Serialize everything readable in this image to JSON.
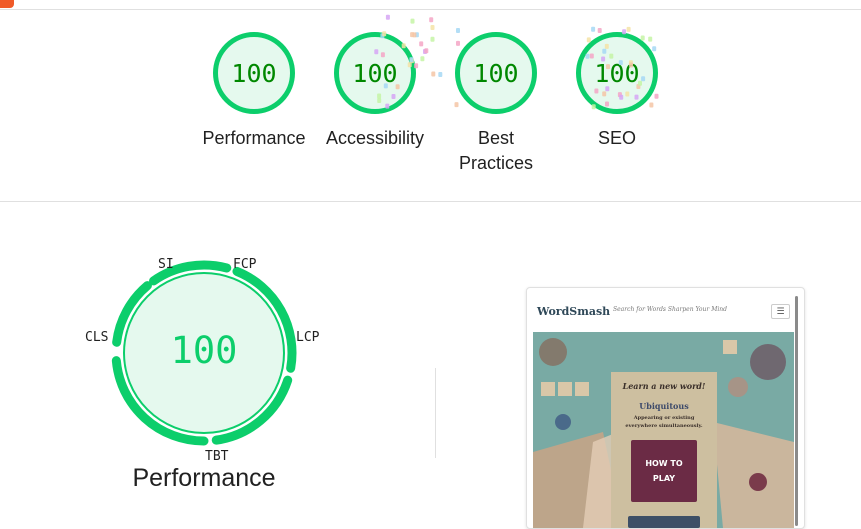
{
  "categories": [
    {
      "id": "performance",
      "score": "100",
      "label": "Performance"
    },
    {
      "id": "accessibility",
      "score": "100",
      "label": "Accessibility"
    },
    {
      "id": "best-practices",
      "score": "100",
      "label": "Best Practices"
    },
    {
      "id": "seo",
      "score": "100",
      "label": "SEO"
    }
  ],
  "performance": {
    "score": "100",
    "title": "Performance",
    "metrics": {
      "si": "SI",
      "fcp": "FCP",
      "lcp": "LCP",
      "tbt": "TBT",
      "cls": "CLS"
    }
  },
  "screenshot": {
    "brand": "WordSmash",
    "tagline": "Search for Words Sharpen Your Mind",
    "menu_icon": "hamburger-icon",
    "card_title": "Learn a new word!",
    "word": "Ubiquitous",
    "definition": "Appearing or existing everywhere simultaneously.",
    "button": "HOW TO PLAY"
  },
  "colors": {
    "pass": "#0cce6b",
    "pass_text": "#008800",
    "pass_fill": "#e5f9ee"
  }
}
